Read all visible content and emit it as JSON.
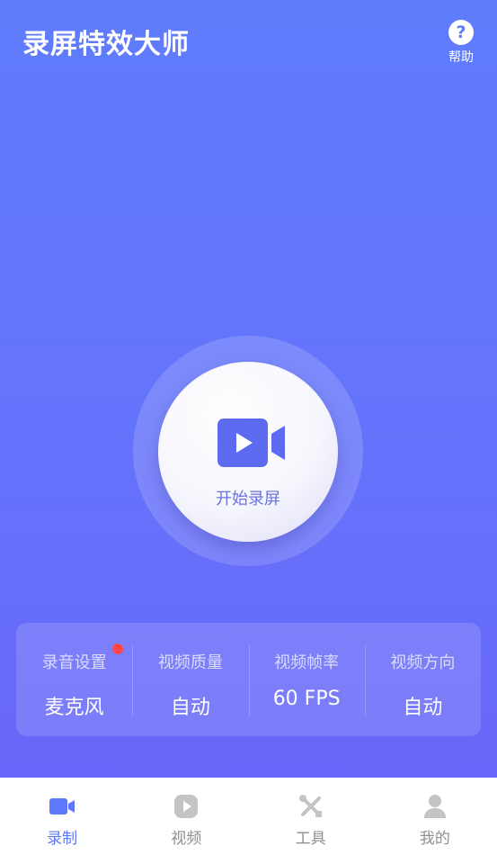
{
  "header": {
    "title": "录屏特效大师",
    "help_icon": "question-icon",
    "help_label": "帮助"
  },
  "record": {
    "icon": "video-camera-icon",
    "label": "开始录屏"
  },
  "settings": [
    {
      "title": "录音设置",
      "value": "麦克风",
      "has_badge": true
    },
    {
      "title": "视频质量",
      "value": "自动"
    },
    {
      "title": "视频帧率",
      "value": "60 FPS"
    },
    {
      "title": "视频方向",
      "value": "自动"
    }
  ],
  "tabs": [
    {
      "label": "录制",
      "icon": "video-camera-icon",
      "active": true
    },
    {
      "label": "视频",
      "icon": "play-icon",
      "active": false
    },
    {
      "label": "工具",
      "icon": "tools-icon",
      "active": false
    },
    {
      "label": "我的",
      "icon": "user-icon",
      "active": false
    }
  ],
  "colors": {
    "primary": "#5f7cfb",
    "badge": "#ff4747",
    "tab_inactive": "#c4c4c4",
    "tab_active": "#5d78fb"
  }
}
